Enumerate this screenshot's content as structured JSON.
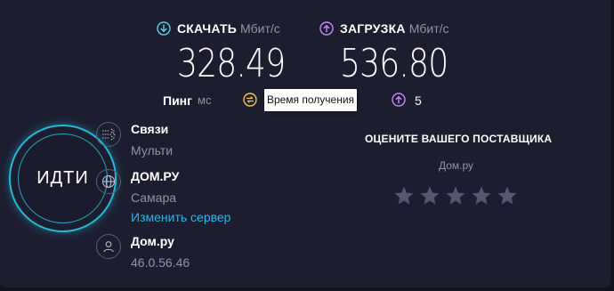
{
  "download": {
    "label": "СКАЧАТЬ",
    "unit": "Мбит/с",
    "value": "328.49",
    "icon": "download-arrow-icon",
    "color": "#5ad1e6"
  },
  "upload": {
    "label": "ЗАГРУЗКА",
    "unit": "Мбит/с",
    "value": "536.80",
    "icon": "upload-arrow-icon",
    "color": "#c58af9"
  },
  "ping": {
    "label": "Пинг",
    "unit": "мс",
    "jitter_icon": "jitter-icon",
    "upload_icon": "upload-arrow-icon",
    "upload_value": "5"
  },
  "tooltip": {
    "text": "Время получения"
  },
  "go_button": {
    "label": "ИДТИ",
    "accent": "#2ab8d8"
  },
  "connections": {
    "icon": "connections-icon",
    "title": "Связи",
    "value": "Мульти"
  },
  "server": {
    "icon": "globe-icon",
    "title": "ДОМ.РУ",
    "location": "Самара",
    "change_link": "Изменить сервер"
  },
  "provider": {
    "icon": "user-icon",
    "title": "Дом.ру",
    "ip": "46.0.56.46"
  },
  "rating": {
    "title": "ОЦЕНИТЕ ВАШЕГО ПОСТАВЩИКА",
    "isp": "Дом.ру",
    "stars": 5,
    "filled": 0,
    "star_color": "#55586e"
  },
  "link_color": "#2fb3ee"
}
